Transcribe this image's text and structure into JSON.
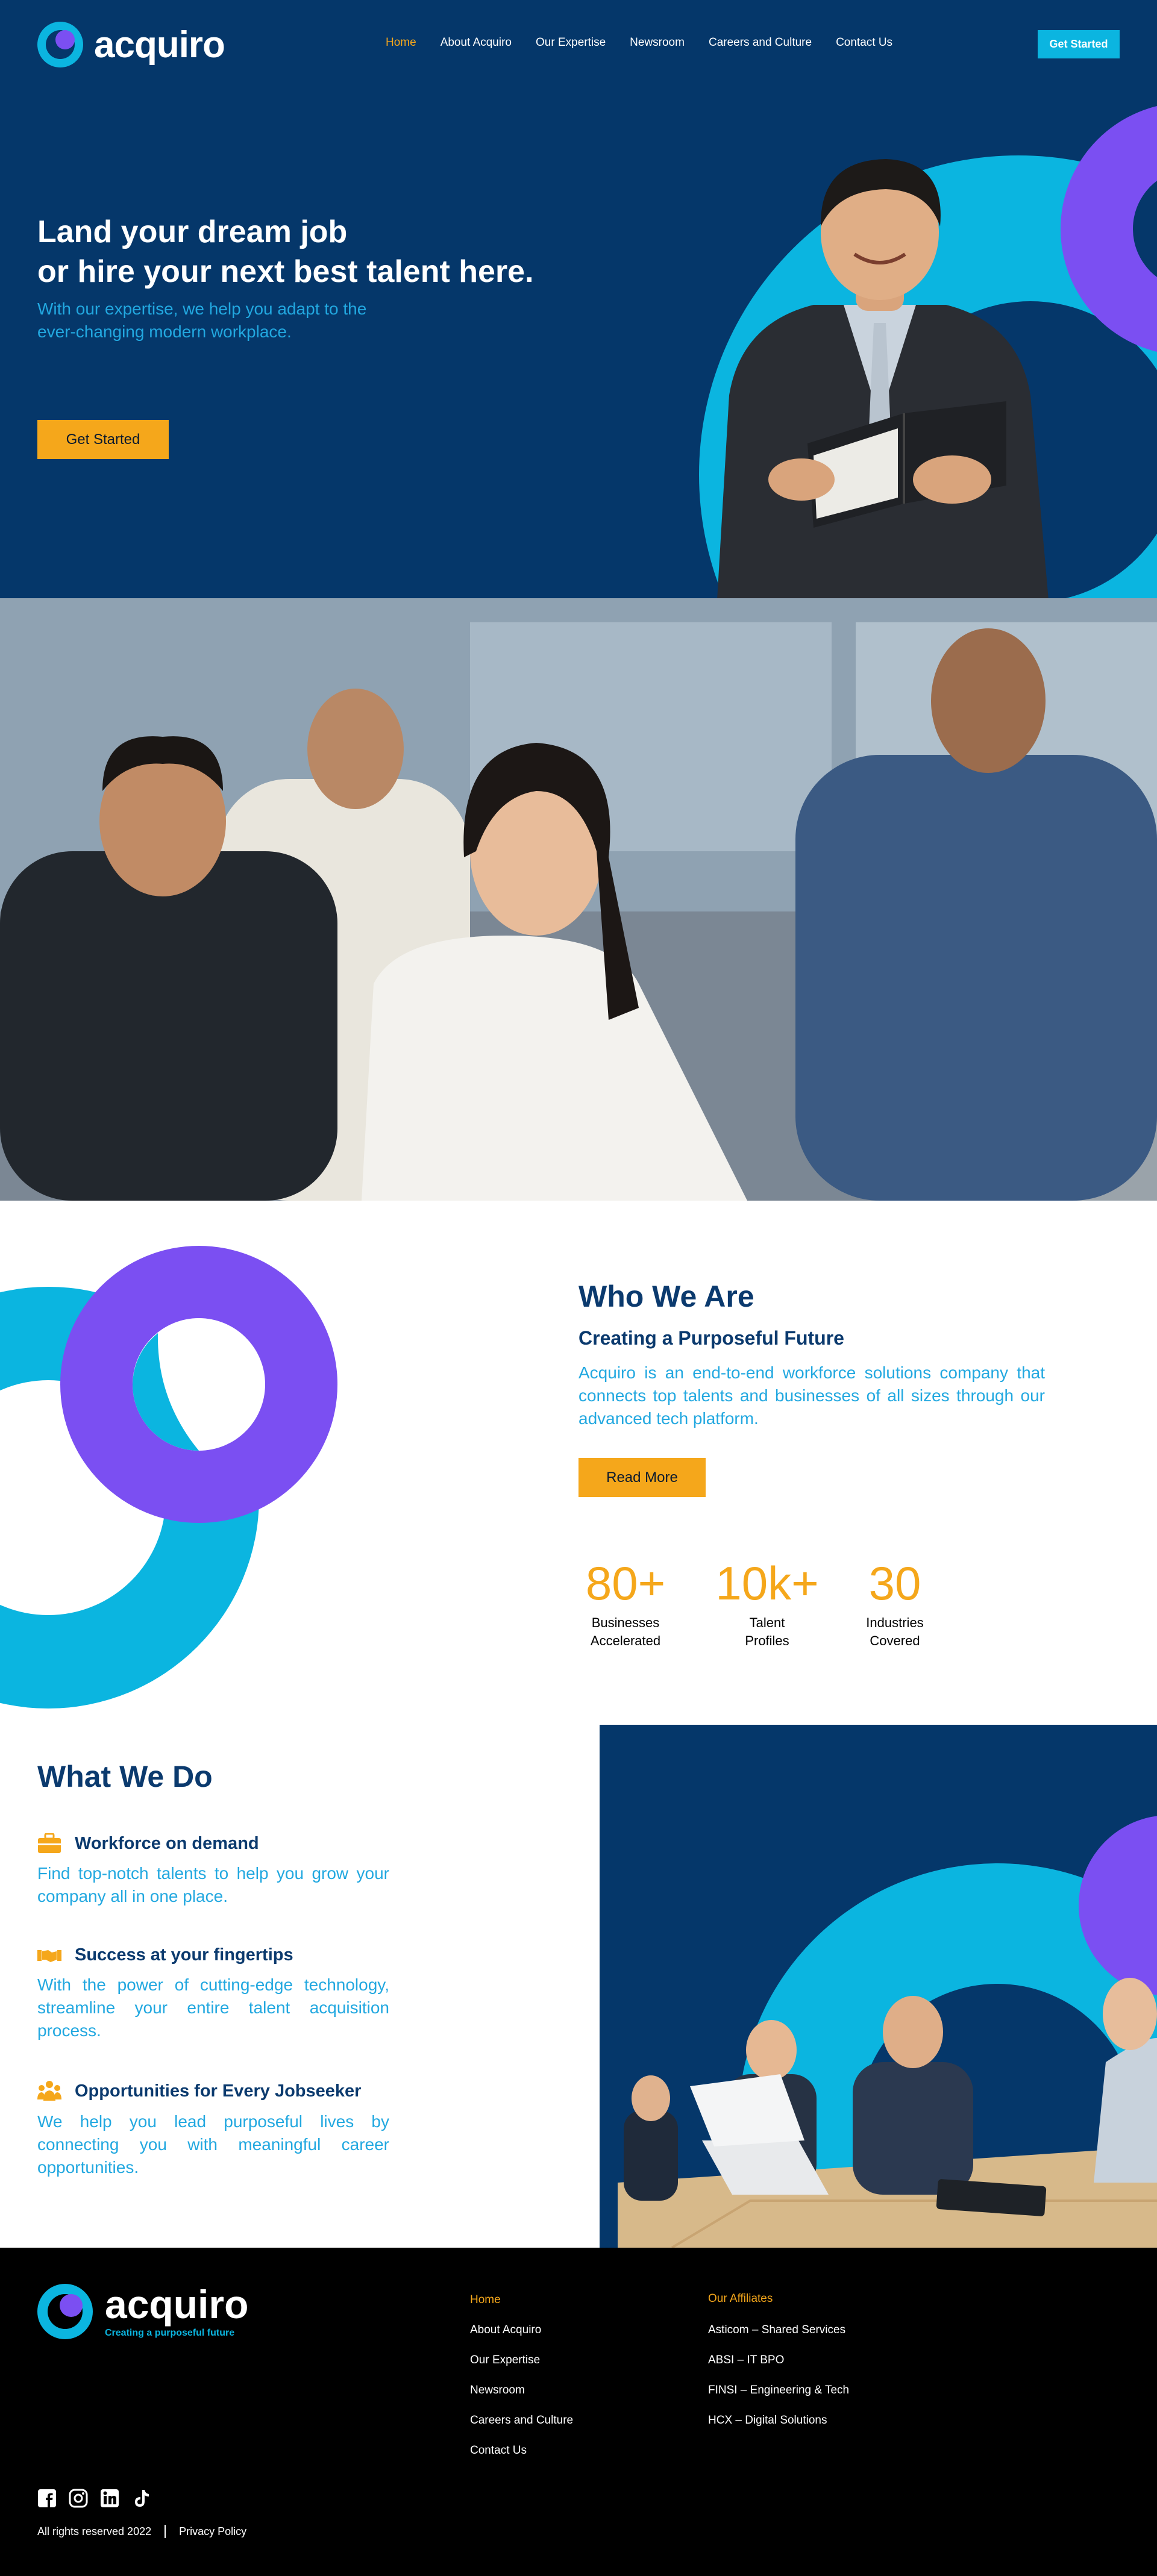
{
  "colors": {
    "navy": "#05376a",
    "cyan": "#0bb5e0",
    "purple": "#7b4ff2",
    "gold": "#f5a71b",
    "light_blue": "#22a8e0"
  },
  "brand": {
    "name": "acquiro",
    "tagline": "Creating a purposeful future"
  },
  "nav": {
    "items": [
      "Home",
      "About Acquiro",
      "Our Expertise",
      "Newsroom",
      "Careers and Culture",
      "Contact Us"
    ],
    "cta": "Get Started"
  },
  "hero": {
    "title_line1": "Land your dream job",
    "title_line2": "or hire your next best talent here.",
    "subtitle_line1": "With our expertise, we help you adapt to the",
    "subtitle_line2": "ever-changing modern workplace.",
    "button": "Get Started"
  },
  "who": {
    "title": "Who We Are",
    "subtitle": "Creating a Purposeful Future",
    "text": "Acquiro is an end-to-end workforce solutions company that connects top talents and businesses of all sizes through our advanced tech platform.",
    "button": "Read More",
    "stats": [
      {
        "value": "80+",
        "label_line1": "Businesses",
        "label_line2": "Accelerated"
      },
      {
        "value": "10k+",
        "label_line1": "Talent",
        "label_line2": "Profiles"
      },
      {
        "value": "30",
        "label_line1": "Industries",
        "label_line2": "Covered"
      }
    ]
  },
  "what": {
    "title": "What We Do",
    "features": [
      {
        "icon": "briefcase-icon",
        "title": "Workforce on demand",
        "text": "Find top-notch talents to help you grow your company all in one place."
      },
      {
        "icon": "handshake-icon",
        "title": "Success at your fingertips",
        "text": "With the power of cutting-edge technology, streamline your entire talent acquisition process."
      },
      {
        "icon": "team-icon",
        "title": "Opportunities for Every Jobseeker",
        "text": "We help you lead purposeful lives by connecting you with meaningful career opportunities."
      }
    ]
  },
  "footer": {
    "links": [
      "Home",
      "About Acquiro",
      "Our Expertise",
      "Newsroom",
      "Careers and Culture",
      "Contact Us"
    ],
    "affiliates_heading": "Our Affiliates",
    "affiliates": [
      "Asticom – Shared Services",
      "ABSI – IT BPO",
      "FINSI – Engineering & Tech",
      "HCX – Digital Solutions"
    ],
    "social": [
      "facebook-icon",
      "instagram-icon",
      "linkedin-icon",
      "tiktok-icon"
    ],
    "copyright": "All rights reserved 2022",
    "privacy": "Privacy Policy"
  }
}
